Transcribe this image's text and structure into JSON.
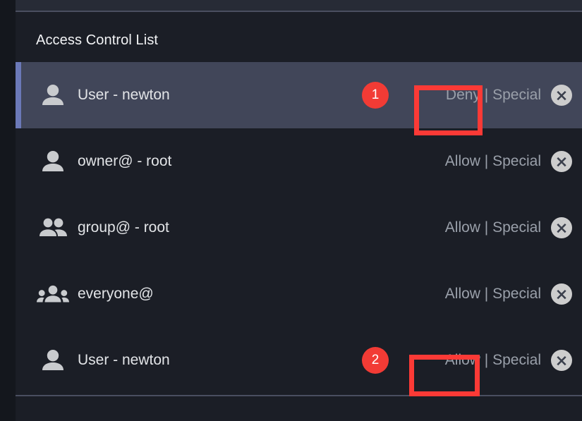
{
  "panel": {
    "title": "Access Control List"
  },
  "colors": {
    "page_background": "#14171d",
    "panel_background": "#1b1e26",
    "selected_row_background": "#414659",
    "selected_row_accent": "#6b79b8",
    "badge_red": "#f23b35",
    "highlight_box_red": "#fb3a36",
    "permission_text": "#9aa0aa",
    "label_text": "#e2e4e7",
    "close_button_background": "#cdcdcd"
  },
  "acl": {
    "rows": [
      {
        "icon": "person-icon",
        "label": "User - newton",
        "permission": "Deny",
        "permission_separator": "|",
        "permission_type": "Special",
        "badge": "1",
        "selected": true,
        "close_label": "x"
      },
      {
        "icon": "person-icon",
        "label": "owner@ - root",
        "permission": "Allow",
        "permission_separator": "|",
        "permission_type": "Special",
        "badge": "",
        "selected": false,
        "close_label": "x"
      },
      {
        "icon": "people-icon",
        "label": "group@ - root",
        "permission": "Allow",
        "permission_separator": "|",
        "permission_type": "Special",
        "badge": "",
        "selected": false,
        "close_label": "x"
      },
      {
        "icon": "groups-icon",
        "label": "everyone@",
        "permission": "Allow",
        "permission_separator": "|",
        "permission_type": "Special",
        "badge": "",
        "selected": false,
        "close_label": "x"
      },
      {
        "icon": "person-icon",
        "label": "User - newton",
        "permission": "Allow",
        "permission_separator": "|",
        "permission_type": "Special",
        "badge": "2",
        "selected": false,
        "close_label": "x"
      }
    ]
  },
  "annotations": [
    {
      "name": "highlight-box-deny",
      "target": "row 1 permission \"Deny\""
    },
    {
      "name": "highlight-box-allow",
      "target": "row 5 permission \"Allow\""
    }
  ]
}
